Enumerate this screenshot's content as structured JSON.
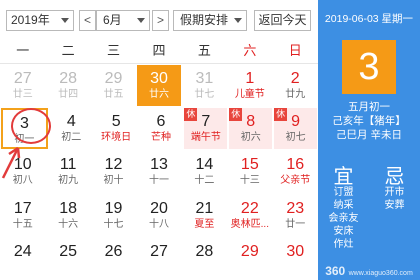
{
  "toolbar": {
    "year": "2019年",
    "prev": "<",
    "month": "6月",
    "next": ">",
    "holiday": "假期安排",
    "today": "返回今天"
  },
  "weekdays": [
    "一",
    "二",
    "三",
    "四",
    "五",
    "六",
    "日"
  ],
  "weeks": [
    [
      {
        "num": "27",
        "sub": "廿三",
        "kind": "other"
      },
      {
        "num": "28",
        "sub": "廿四",
        "kind": "other"
      },
      {
        "num": "29",
        "sub": "廿五",
        "kind": "other"
      },
      {
        "num": "30",
        "sub": "廿六",
        "kind": "today"
      },
      {
        "num": "31",
        "sub": "廿七",
        "kind": "other"
      },
      {
        "num": "1",
        "sub": "儿童节",
        "kind": "weekend festival"
      },
      {
        "num": "2",
        "sub": "廿九",
        "kind": "weekend"
      }
    ],
    [
      {
        "num": "3",
        "sub": "初一",
        "kind": "selected"
      },
      {
        "num": "4",
        "sub": "初二",
        "kind": ""
      },
      {
        "num": "5",
        "sub": "环境日",
        "kind": "festival"
      },
      {
        "num": "6",
        "sub": "芒种",
        "kind": "festival"
      },
      {
        "num": "7",
        "sub": "端午节",
        "kind": "holiday festival",
        "badge": "休"
      },
      {
        "num": "8",
        "sub": "初六",
        "kind": "holiday weekend",
        "badge": "休"
      },
      {
        "num": "9",
        "sub": "初七",
        "kind": "holiday weekend",
        "badge": "休"
      }
    ],
    [
      {
        "num": "10",
        "sub": "初八",
        "kind": ""
      },
      {
        "num": "11",
        "sub": "初九",
        "kind": ""
      },
      {
        "num": "12",
        "sub": "初十",
        "kind": ""
      },
      {
        "num": "13",
        "sub": "十一",
        "kind": ""
      },
      {
        "num": "14",
        "sub": "十二",
        "kind": ""
      },
      {
        "num": "15",
        "sub": "十三",
        "kind": "weekend"
      },
      {
        "num": "16",
        "sub": "父亲节",
        "kind": "weekend festival"
      }
    ],
    [
      {
        "num": "17",
        "sub": "十五",
        "kind": ""
      },
      {
        "num": "18",
        "sub": "十六",
        "kind": ""
      },
      {
        "num": "19",
        "sub": "十七",
        "kind": ""
      },
      {
        "num": "20",
        "sub": "十八",
        "kind": ""
      },
      {
        "num": "21",
        "sub": "夏至",
        "kind": "festival"
      },
      {
        "num": "22",
        "sub": "奥林匹...",
        "kind": "weekend festival"
      },
      {
        "num": "23",
        "sub": "廿一",
        "kind": "weekend"
      }
    ],
    [
      {
        "num": "24",
        "sub": "",
        "kind": ""
      },
      {
        "num": "25",
        "sub": "",
        "kind": ""
      },
      {
        "num": "26",
        "sub": "",
        "kind": ""
      },
      {
        "num": "27",
        "sub": "",
        "kind": ""
      },
      {
        "num": "28",
        "sub": "",
        "kind": ""
      },
      {
        "num": "29",
        "sub": "",
        "kind": "weekend"
      },
      {
        "num": "30",
        "sub": "",
        "kind": "weekend"
      }
    ]
  ],
  "panel": {
    "date_line": "2019-06-03 星期一",
    "day": "3",
    "lunar_day": "五月初一",
    "lunar_year": "己亥年【猪年】",
    "lunar_ganzhi": "己巳月 辛未日",
    "yi_title": "宜",
    "ji_title": "忌",
    "yi_items": [
      "订盟",
      "纳采",
      "会亲友",
      "安床",
      "作灶"
    ],
    "ji_items": [
      "开市",
      "安葬"
    ],
    "watermark": "360",
    "watermark_site": "www.xiaguo360.com"
  },
  "colors": {
    "panel_bg": "#3d8fe3",
    "today_bg": "#f59a16",
    "holiday_bg": "#fde9e9",
    "weekend_text": "#e02020",
    "badge_bg": "#e8453c"
  }
}
